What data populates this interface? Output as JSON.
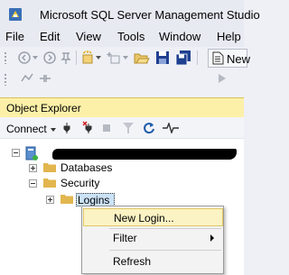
{
  "window": {
    "title": "Microsoft SQL Server Management Studio"
  },
  "menu": {
    "items": [
      "File",
      "Edit",
      "View",
      "Tools",
      "Window",
      "Help"
    ]
  },
  "toolbar": {
    "new_query_label": "New",
    "icons": [
      "back-icon",
      "forward-icon",
      "pin-icon",
      "new-project-icon",
      "add-item-icon",
      "open-icon",
      "save-icon",
      "save-all-icon",
      "new-query-icon"
    ]
  },
  "object_explorer": {
    "title": "Object Explorer",
    "connect_label": "Connect",
    "toolbar_icons": [
      "connect-icon",
      "disconnect-icon",
      "stop-icon",
      "filter-icon",
      "refresh-icon",
      "activity-monitor-icon"
    ],
    "tree": {
      "server": "",
      "databases": "Databases",
      "security": "Security",
      "logins": "Logins"
    }
  },
  "context_menu": {
    "items": [
      {
        "label": "New Login...",
        "highlighted": true
      },
      {
        "label": "Filter",
        "has_submenu": true
      },
      {
        "label": "Refresh"
      }
    ]
  },
  "colors": {
    "header_accent": "#fcf0a8",
    "selection": "#cce2f7",
    "menu_highlight": "#fcf3c4"
  }
}
